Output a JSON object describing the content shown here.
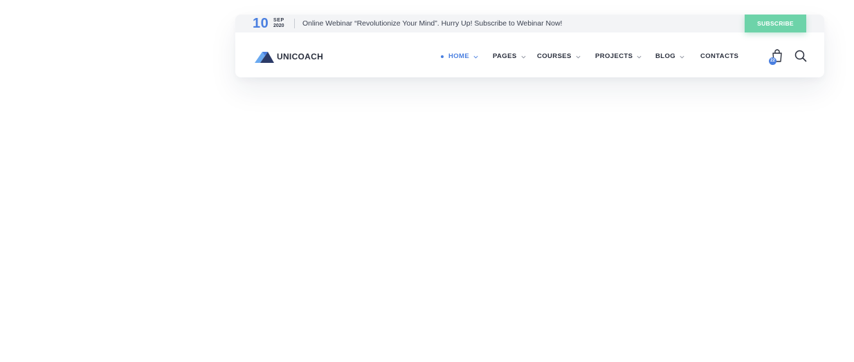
{
  "topbar": {
    "day": "10",
    "month": "SEP",
    "year": "2020",
    "announcement": "Online Webinar “Revolutionize Your Mind”. Hurry Up! Subscribe to Webinar Now!",
    "subscribe_label": "SUBSCRIBE"
  },
  "header": {
    "brand": "UNICOACH",
    "nav": [
      {
        "label": "HOME",
        "active": true,
        "dropdown": true
      },
      {
        "label": "PAGES",
        "dropdown": true
      },
      {
        "label": "COURSES",
        "dropdown": true
      },
      {
        "label": "PROJECTS",
        "dropdown": true
      },
      {
        "label": "BLOG",
        "dropdown": true
      },
      {
        "label": "CONTACTS",
        "dropdown": false
      }
    ],
    "cart_count": "22"
  },
  "colors": {
    "accent": "#4a7fe0",
    "subscribe": "#6dd3a9",
    "text": "#2a2f3d"
  },
  "icons": [
    "logo-mountain-icon",
    "chevron-down-icon",
    "shopping-bag-icon",
    "search-icon"
  ]
}
